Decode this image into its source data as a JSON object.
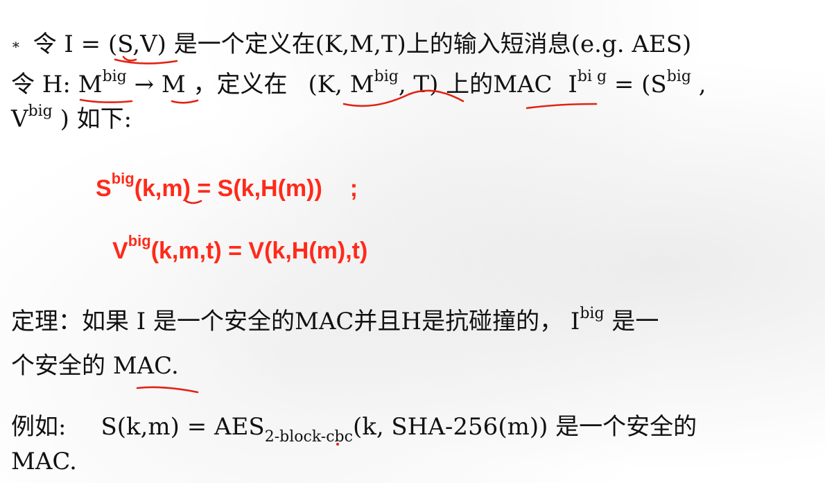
{
  "colors": {
    "text": "#111111",
    "formula": "#ff2a1a",
    "annotation": "#e32214"
  },
  "line1": {
    "bullet": "∗",
    "prefix": "令 I = ",
    "sv": "(S,V)",
    "suffix": " 是一个定义在(K,M,T)上的输入短消息(e.g. AES)"
  },
  "line2": {
    "t1": "令 H: ",
    "m": "M",
    "big": "big",
    "arrow": " → ",
    "m2": "M",
    "t2": " ，定义在",
    "k": "(K, M",
    "big2": "big",
    "t3": ", T)",
    "t4": " 上的",
    "mac": "MAC",
    "i": " I",
    "big3": "bi g",
    "t5": " = (S",
    "big4": "big",
    "t6": " ,"
  },
  "line3": {
    "v": "V",
    "big": "big",
    "t1": " ) 如下:"
  },
  "formula1": {
    "s": "S",
    "big": "big",
    "rest": "(k,m) = S(k,H(m))",
    "semicolon": ";"
  },
  "formula2": {
    "v": "V",
    "big": "big",
    "rest": "(k,m,t) = V(k,H(m),t)"
  },
  "theorem": {
    "t1": "定理：如果 I 是一个安全的MAC并且H是抗碰撞的， I",
    "big": "big",
    "t2": " 是一",
    "line2_prefix": "个安全的 ",
    "line2_mac": "MAC."
  },
  "example": {
    "label": "例如:",
    "t1": "S(k,m) = AES",
    "sub": "2-block-cbc",
    "t2": "(k,  SHA-256(m))  是一个安全的",
    "line2": "MAC."
  }
}
